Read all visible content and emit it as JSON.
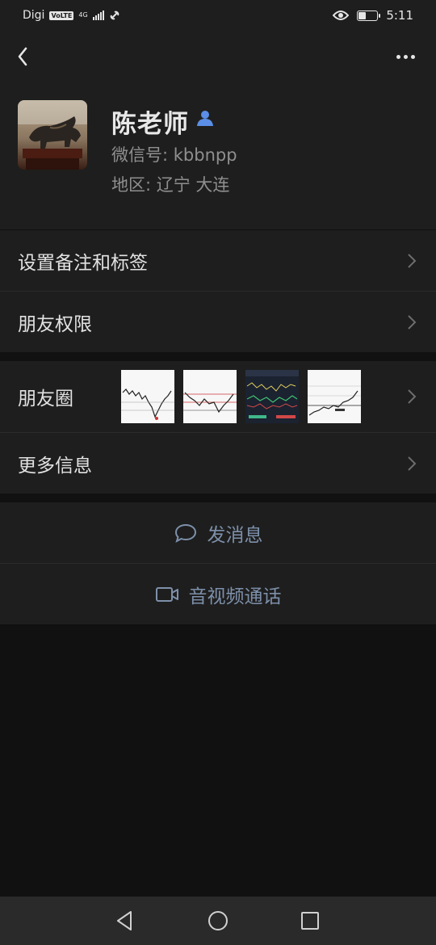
{
  "status_bar": {
    "carrier": "Digi",
    "volte": "VoLTE",
    "network": "4G",
    "time": "5:11"
  },
  "header": {
    "back_icon": "chevron-left-icon",
    "more_icon": "more-dots-icon"
  },
  "profile": {
    "name": "陈老师",
    "wechat_id": "微信号: kbbnpp",
    "region": "地区: 辽宁  大连",
    "avatar": "bull-statue-photo"
  },
  "menu": {
    "remark_tags": "设置备注和标签",
    "friend_permissions": "朋友权限",
    "moments": "朋友圈",
    "more_info": "更多信息"
  },
  "actions": {
    "send_message": "发消息",
    "av_call": "音视频通话"
  },
  "colors": {
    "background": "#111111",
    "panel": "#1e1e1e",
    "accent": "#7d90aa",
    "contact_badge": "#5b8ee6"
  }
}
